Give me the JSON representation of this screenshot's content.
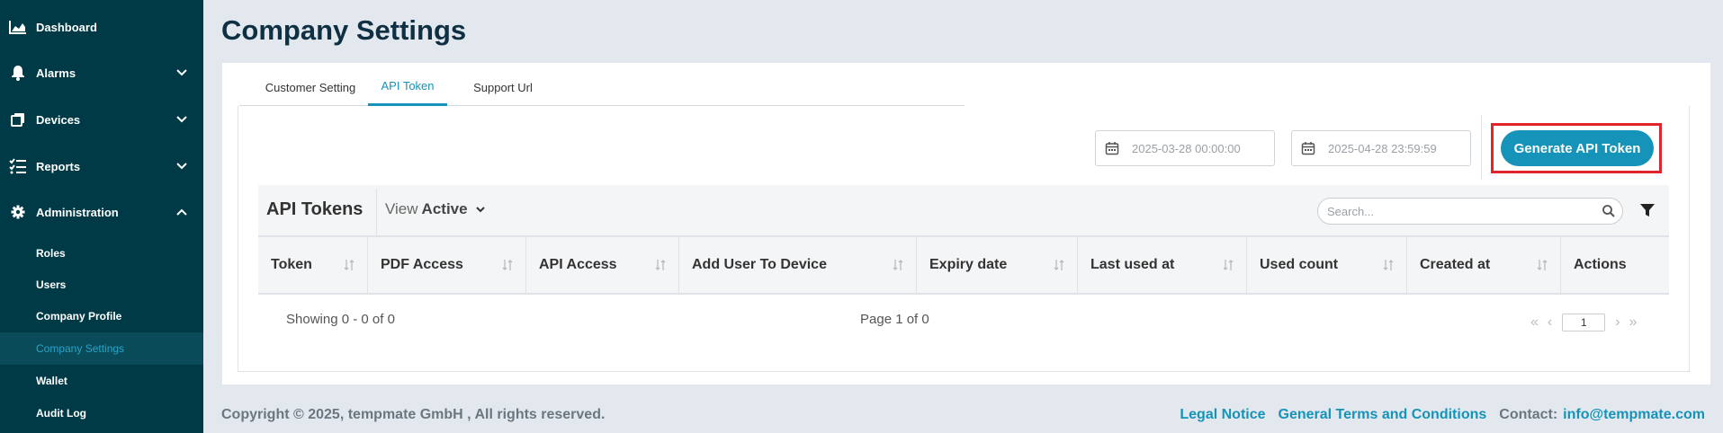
{
  "sidebar": {
    "items": [
      {
        "label": "Dashboard",
        "icon": "chart-area-icon"
      },
      {
        "label": "Alarms",
        "icon": "bell-icon"
      },
      {
        "label": "Devices",
        "icon": "devices-icon"
      },
      {
        "label": "Reports",
        "icon": "list-check-icon"
      },
      {
        "label": "Administration",
        "icon": "gear-icon"
      }
    ],
    "admin_subitems": [
      "Roles",
      "Users",
      "Company Profile",
      "Company Settings",
      "Wallet",
      "Audit Log"
    ],
    "active_subitem": "Company Settings"
  },
  "page": {
    "title": "Company Settings"
  },
  "tabs": [
    {
      "label": "Customer Setting",
      "active": false
    },
    {
      "label": "API Token",
      "active": true
    },
    {
      "label": "Support Url",
      "active": false
    }
  ],
  "filters": {
    "start_date": "2025-03-28 00:00:00",
    "end_date": "2025-04-28 23:59:59"
  },
  "generate_button": {
    "label": "Generate API Token"
  },
  "table": {
    "title": "API Tokens",
    "view_label": "View",
    "view_value": "Active",
    "search_placeholder": "Search...",
    "columns": [
      "Token",
      "PDF Access",
      "API Access",
      "Add User To Device",
      "Expiry date",
      "Last used at",
      "Used count",
      "Created at",
      "Actions"
    ],
    "rows": [],
    "showing": "Showing 0 - 0 of 0",
    "page_info": "Page 1 of 0",
    "current_page": "1"
  },
  "footer": {
    "copyright": "Copyright © 2025, tempmate GmbH , All rights reserved.",
    "legal": "Legal Notice",
    "terms": "General Terms and Conditions",
    "contact_label": "Contact:",
    "email": "info@tempmate.com"
  },
  "colors": {
    "sidebar_bg": "#003a46",
    "accent": "#1593b8",
    "highlight": "#e1232a",
    "page_bg": "#e3e8ef"
  }
}
